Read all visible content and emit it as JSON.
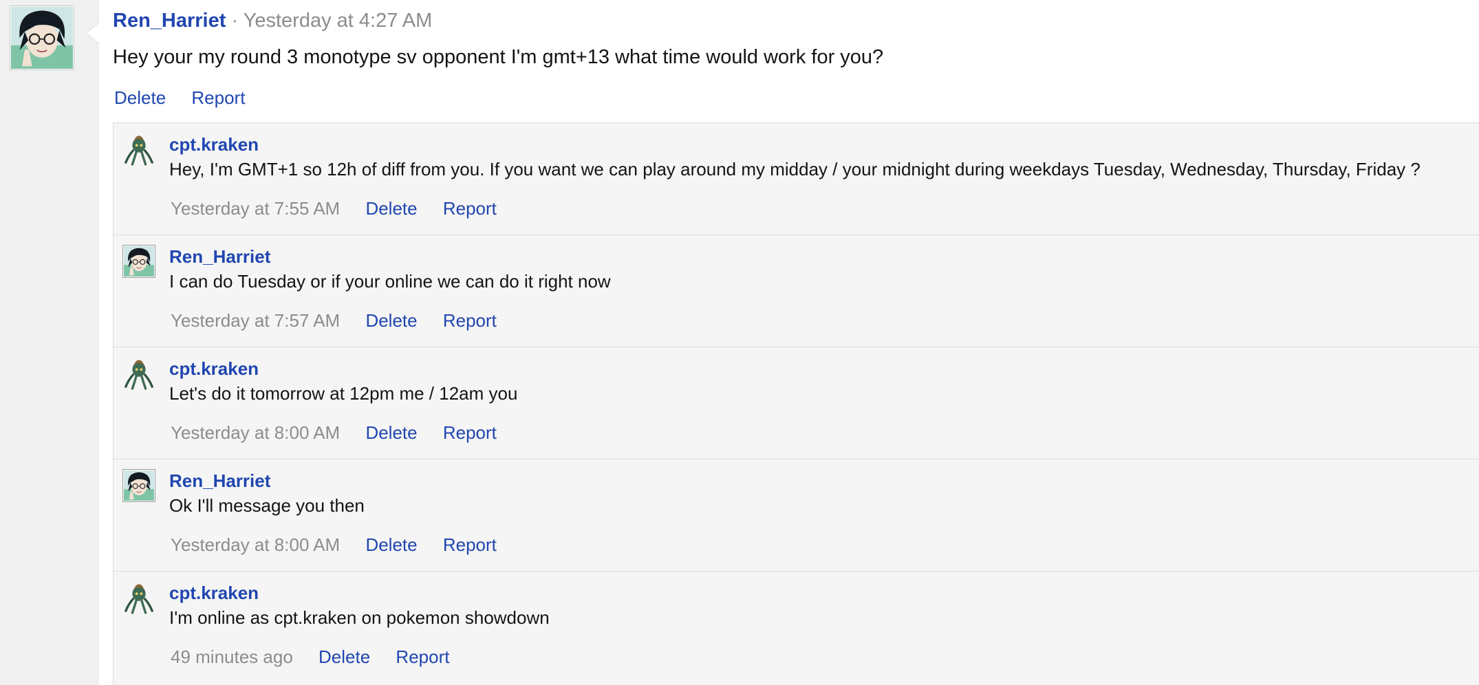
{
  "post": {
    "username": "Ren_Harriet",
    "separator": "·",
    "time": "Yesterday at 4:27 AM",
    "message": "Hey your my round 3 monotype sv opponent I'm gmt+13 what time would work for you?",
    "actions": {
      "delete": "Delete",
      "report": "Report"
    }
  },
  "comments": [
    {
      "username": "cpt.kraken",
      "avatar": "kraken-avatar",
      "text": "Hey, I'm GMT+1 so 12h of diff from you. If you want we can play around my midday / your midnight during weekdays Tuesday, Wednesday, Thursday, Friday ?",
      "time": "Yesterday at 7:55 AM",
      "delete": "Delete",
      "report": "Report"
    },
    {
      "username": "Ren_Harriet",
      "avatar": "harriet-avatar",
      "text": "I can do Tuesday or if your online we can do it right now",
      "time": "Yesterday at 7:57 AM",
      "delete": "Delete",
      "report": "Report"
    },
    {
      "username": "cpt.kraken",
      "avatar": "kraken-avatar",
      "text": "Let's do it tomorrow at 12pm me / 12am you",
      "time": "Yesterday at 8:00 AM",
      "delete": "Delete",
      "report": "Report"
    },
    {
      "username": "Ren_Harriet",
      "avatar": "harriet-avatar",
      "text": "Ok I'll message you then",
      "time": "Yesterday at 8:00 AM",
      "delete": "Delete",
      "report": "Report"
    },
    {
      "username": "cpt.kraken",
      "avatar": "kraken-avatar",
      "text": "I'm online as cpt.kraken on pokemon showdown",
      "time": "49 minutes ago",
      "delete": "Delete",
      "report": "Report"
    }
  ],
  "colors": {
    "link": "#2046b0",
    "meta": "#8c8c8c",
    "comment_bg": "#f5f5f5",
    "gutter_bg": "#f0f0f0"
  }
}
